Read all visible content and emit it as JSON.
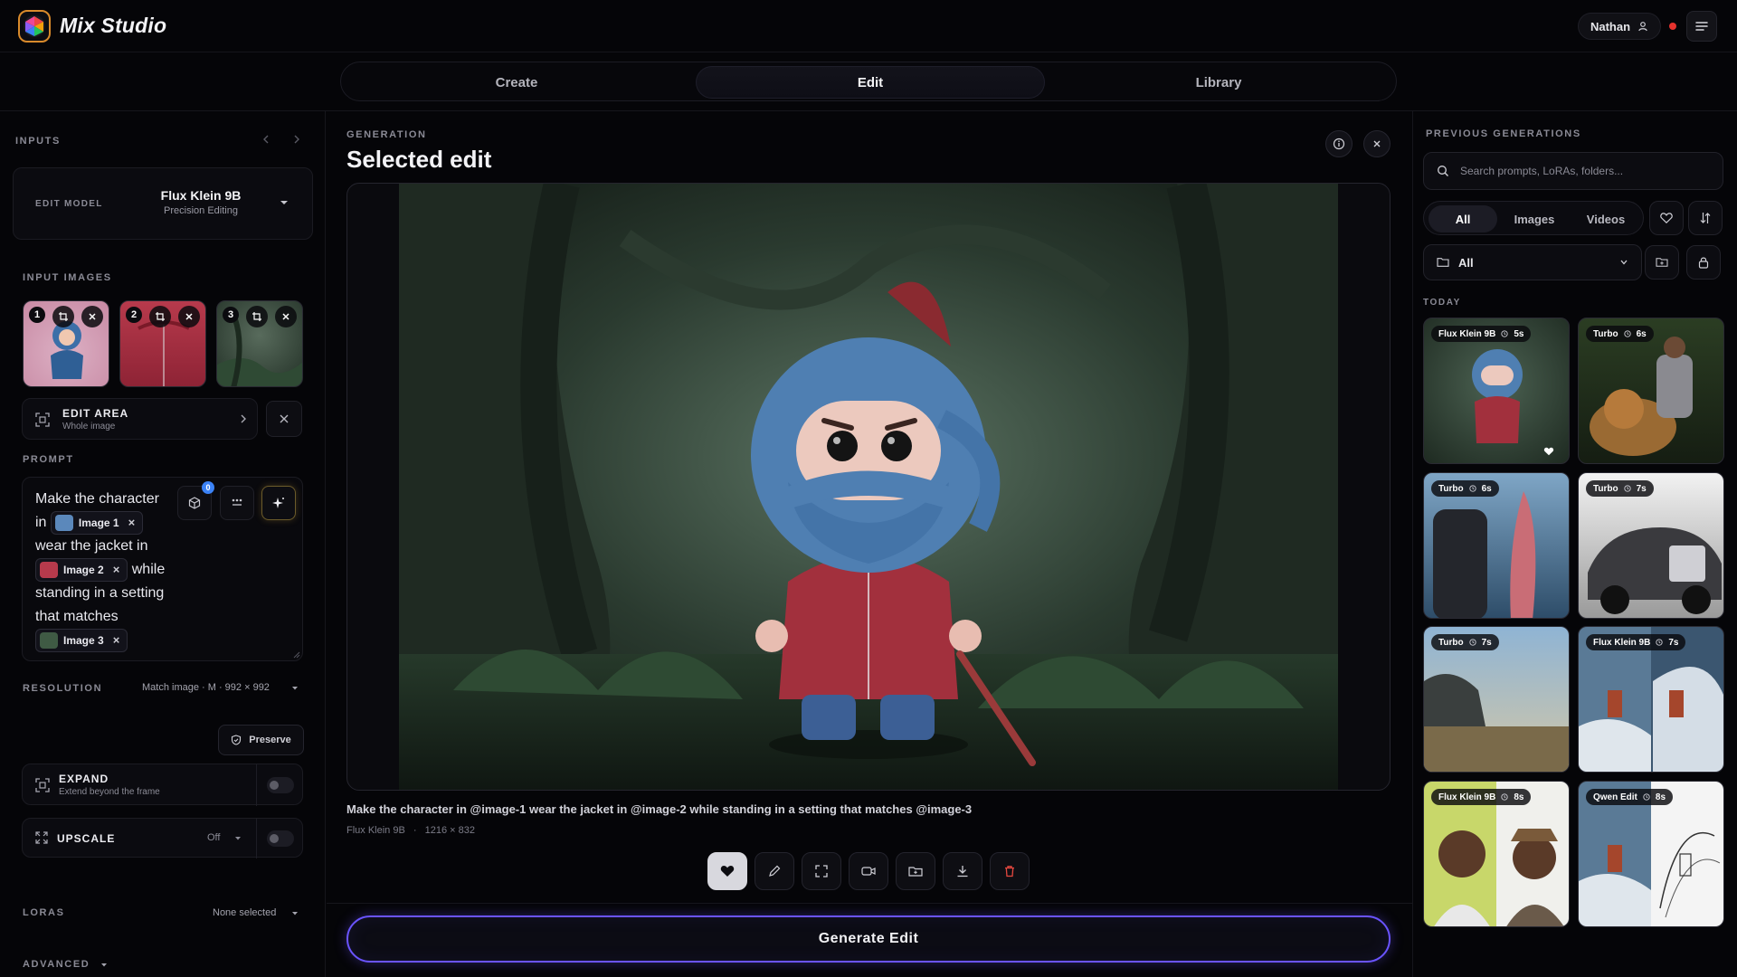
{
  "app": {
    "title": "Mix Studio"
  },
  "user": {
    "name": "Nathan"
  },
  "tabs": [
    {
      "label": "Create",
      "active": false
    },
    {
      "label": "Edit",
      "active": true
    },
    {
      "label": "Library",
      "active": false
    }
  ],
  "left": {
    "inputs_label": "INPUTS",
    "edit_model_label": "EDIT MODEL",
    "model_name": "Flux Klein 9B",
    "model_sub": "Precision Editing",
    "input_images_label": "INPUT IMAGES",
    "thumbs": [
      "1",
      "2",
      "3"
    ],
    "edit_area_title": "EDIT AREA",
    "edit_area_sub": "Whole image",
    "prompt_label": "PROMPT",
    "prompt_counter": "0",
    "prompt": {
      "t1": "Make the character in",
      "c1": "Image 1",
      "t2": "wear the jacket in",
      "c2": "Image 2",
      "t3": "while standing in a setting that matches",
      "c3": "Image 3"
    },
    "resolution_label": "RESOLUTION",
    "resolution_value": "Match image · M · 992 × 992",
    "preserve_label": "Preserve",
    "expand_title": "EXPAND",
    "expand_sub": "Extend beyond the frame",
    "upscale_title": "UPSCALE",
    "upscale_value": "Off",
    "loras_label": "LORAS",
    "loras_value": "None selected",
    "advanced_label": "ADVANCED"
  },
  "center": {
    "section_label": "GENERATION",
    "title": "Selected edit",
    "caption": "Make the character in @image-1 wear the jacket in @image-2 while standing in a setting that matches @image-3",
    "meta_model": "Flux Klein 9B",
    "meta_sep": "·",
    "meta_size": "1216 × 832",
    "generate_label": "Generate Edit"
  },
  "right": {
    "section_label": "PREVIOUS GENERATIONS",
    "search_placeholder": "Search prompts, LoRAs, folders...",
    "filters": [
      {
        "label": "All",
        "active": true
      },
      {
        "label": "Images",
        "active": false
      },
      {
        "label": "Videos",
        "active": false
      }
    ],
    "folder_label": "All",
    "today_label": "TODAY",
    "cards": [
      {
        "model": "Flux Klein 9B",
        "time": "5s"
      },
      {
        "model": "Turbo",
        "time": "6s"
      },
      {
        "model": "Turbo",
        "time": "6s"
      },
      {
        "model": "Turbo",
        "time": "7s"
      },
      {
        "model": "Turbo",
        "time": "7s"
      },
      {
        "model": "Flux Klein 9B",
        "time": "7s"
      },
      {
        "model": "Flux Klein 9B",
        "time": "8s"
      },
      {
        "model": "Qwen Edit",
        "time": "8s"
      }
    ]
  },
  "colors": {
    "accent": "#6a54ff",
    "danger": "#e5322d",
    "logo_ring": "#d98a2b"
  }
}
